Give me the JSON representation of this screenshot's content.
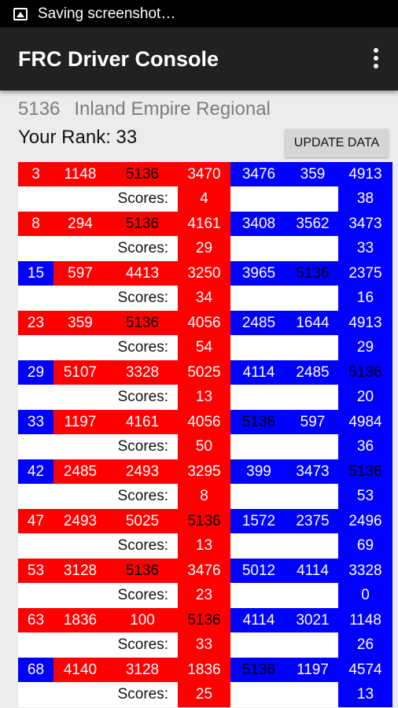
{
  "status_bar": {
    "text": "Saving screenshot…",
    "icon": "image-icon"
  },
  "app_bar": {
    "title": "FRC Driver Console",
    "menu_icon": "more-vert-icon"
  },
  "header": {
    "team": "5136",
    "event": "Inland Empire Regional",
    "rank_text": "Your Rank: 33",
    "update_button": "UPDATE DATA"
  },
  "scores_label": "Scores:",
  "colors": {
    "red_alliance": "#ff0000",
    "blue_alliance": "#0000ff",
    "highlight_team_text": "#000000"
  },
  "matches": [
    {
      "match": "3",
      "match_alliance": "red",
      "red": [
        "1148",
        "5136",
        "3470"
      ],
      "blue": [
        "3476",
        "359",
        "4913"
      ],
      "red_score": "4",
      "blue_score": "38"
    },
    {
      "match": "8",
      "match_alliance": "red",
      "red": [
        "294",
        "5136",
        "4161"
      ],
      "blue": [
        "3408",
        "3562",
        "3473"
      ],
      "red_score": "29",
      "blue_score": "33"
    },
    {
      "match": "15",
      "match_alliance": "blue",
      "red": [
        "597",
        "4413",
        "3250"
      ],
      "blue": [
        "3965",
        "5136",
        "2375"
      ],
      "red_score": "34",
      "blue_score": "16"
    },
    {
      "match": "23",
      "match_alliance": "red",
      "red": [
        "359",
        "5136",
        "4056"
      ],
      "blue": [
        "2485",
        "1644",
        "4913"
      ],
      "red_score": "54",
      "blue_score": "29"
    },
    {
      "match": "29",
      "match_alliance": "blue",
      "red": [
        "5107",
        "3328",
        "5025"
      ],
      "blue": [
        "4114",
        "2485",
        "5136"
      ],
      "red_score": "13",
      "blue_score": "20"
    },
    {
      "match": "33",
      "match_alliance": "blue",
      "red": [
        "1197",
        "4161",
        "4056"
      ],
      "blue": [
        "5136",
        "597",
        "4984"
      ],
      "red_score": "50",
      "blue_score": "36"
    },
    {
      "match": "42",
      "match_alliance": "blue",
      "red": [
        "2485",
        "2493",
        "3295"
      ],
      "blue": [
        "399",
        "3473",
        "5136"
      ],
      "red_score": "8",
      "blue_score": "53"
    },
    {
      "match": "47",
      "match_alliance": "red",
      "red": [
        "2493",
        "5025",
        "5136"
      ],
      "blue": [
        "1572",
        "2375",
        "2496"
      ],
      "red_score": "13",
      "blue_score": "69"
    },
    {
      "match": "53",
      "match_alliance": "red",
      "red": [
        "3128",
        "5136",
        "3476"
      ],
      "blue": [
        "5012",
        "4114",
        "3328"
      ],
      "red_score": "23",
      "blue_score": "0"
    },
    {
      "match": "63",
      "match_alliance": "red",
      "red": [
        "1836",
        "100",
        "5136"
      ],
      "blue": [
        "4114",
        "3021",
        "1148"
      ],
      "red_score": "33",
      "blue_score": "26"
    },
    {
      "match": "68",
      "match_alliance": "blue",
      "red": [
        "4140",
        "3128",
        "1836"
      ],
      "blue": [
        "5136",
        "1197",
        "4574"
      ],
      "red_score": "25",
      "blue_score": "13"
    }
  ]
}
